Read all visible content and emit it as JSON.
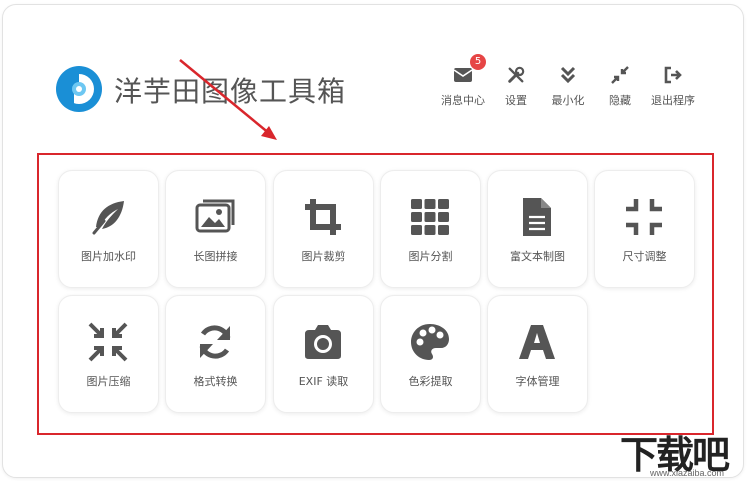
{
  "app": {
    "title": "洋芋田图像工具箱"
  },
  "toolbar": {
    "items": [
      {
        "label": "消息中心",
        "badge": "5"
      },
      {
        "label": "设置"
      },
      {
        "label": "最小化"
      },
      {
        "label": "隐藏"
      },
      {
        "label": "退出程序"
      }
    ]
  },
  "tools": [
    {
      "label": "图片加水印",
      "icon": "feather-icon"
    },
    {
      "label": "长图拼接",
      "icon": "images-icon"
    },
    {
      "label": "图片裁剪",
      "icon": "crop-icon"
    },
    {
      "label": "图片分割",
      "icon": "grid-icon"
    },
    {
      "label": "富文本制图",
      "icon": "document-icon"
    },
    {
      "label": "尺寸调整",
      "icon": "compress-icon"
    },
    {
      "label": "图片压缩",
      "icon": "shrink-icon"
    },
    {
      "label": "格式转换",
      "icon": "sync-icon"
    },
    {
      "label": "EXIF 读取",
      "icon": "camera-icon"
    },
    {
      "label": "色彩提取",
      "icon": "palette-icon"
    },
    {
      "label": "字体管理",
      "icon": "font-icon"
    }
  ],
  "watermark": {
    "text": "下载吧",
    "url": "www.xiazaiba.com"
  },
  "colors": {
    "icon": "#555555",
    "highlight": "#d9262c",
    "badge": "#e64545",
    "logo": "#1a8fd6"
  }
}
